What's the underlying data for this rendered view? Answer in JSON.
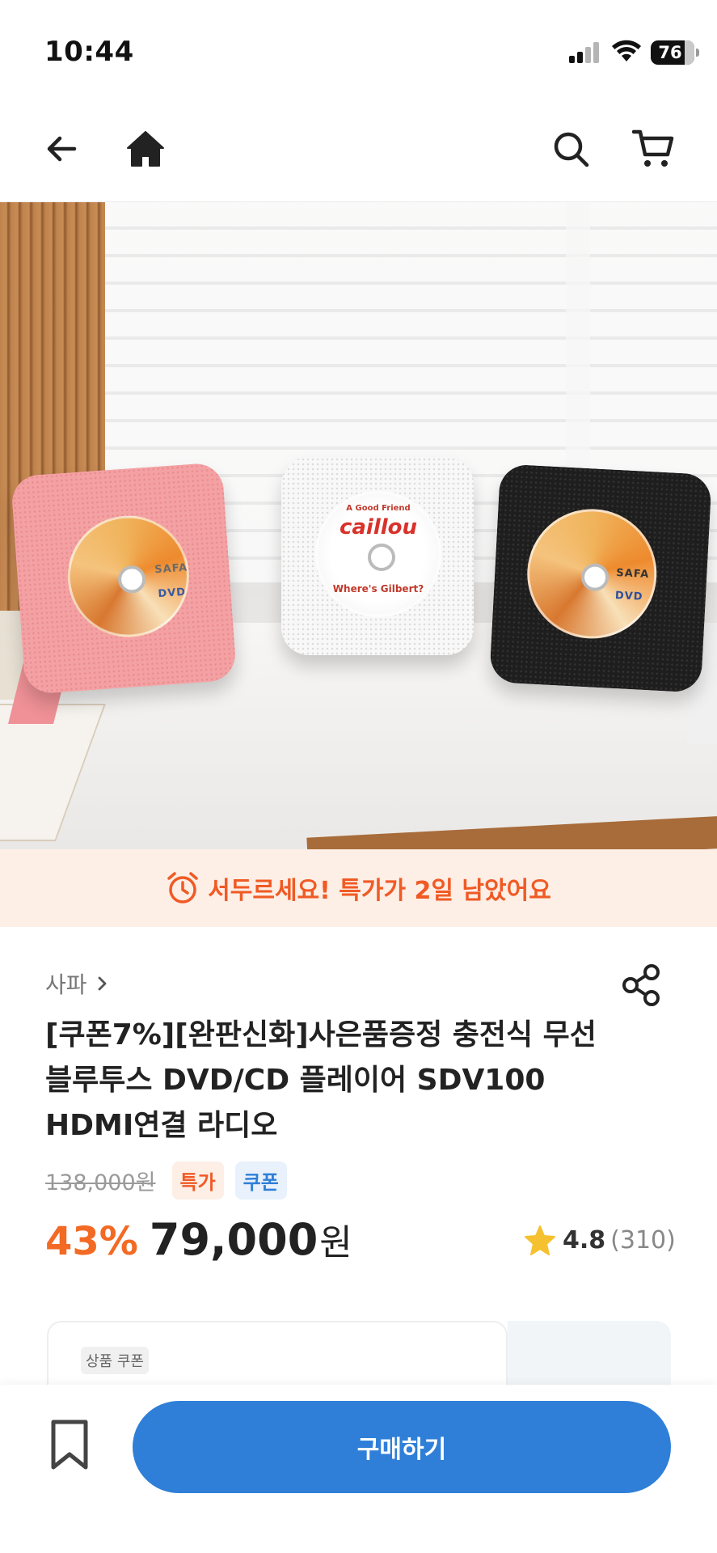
{
  "status_bar": {
    "time": "10:44",
    "battery": "76"
  },
  "nav": {
    "back_icon": "arrow-left-icon",
    "home_icon": "home-icon",
    "search_icon": "search-icon",
    "cart_icon": "cart-icon"
  },
  "hero": {
    "slide_count": 8,
    "active_slide": 1,
    "disc_texts": {
      "brand": "SAFA",
      "format": "DVD",
      "cartoon_title": "caillou",
      "cartoon_subtitle": "Where's Gilbert?",
      "cartoon_top": "A Good Friend"
    }
  },
  "urgency": {
    "text": "서두르세요! 특가가 2일 남았어요",
    "icon": "alarm-clock-icon",
    "color": "#f05a24"
  },
  "product": {
    "seller": "사파",
    "title": "[쿠폰7%][완판신화]사은품증정 충전식 무선 블루투스 DVD/CD 플레이어 SDV100 HDMI연결 라디오",
    "original_price": "138,000원",
    "badges": [
      "특가",
      "쿠폰"
    ],
    "discount": "43%",
    "price": "79,000",
    "currency": "원",
    "rating": "4.8",
    "review_count": "(310)"
  },
  "coupon_card": {
    "label": "상품 쿠폰"
  },
  "bottom": {
    "buy_label": "구매하기",
    "bookmark_icon": "bookmark-icon"
  },
  "colors": {
    "accent_orange": "#f26a24",
    "primary_blue": "#2f7fd8",
    "star": "#f6c12f"
  }
}
